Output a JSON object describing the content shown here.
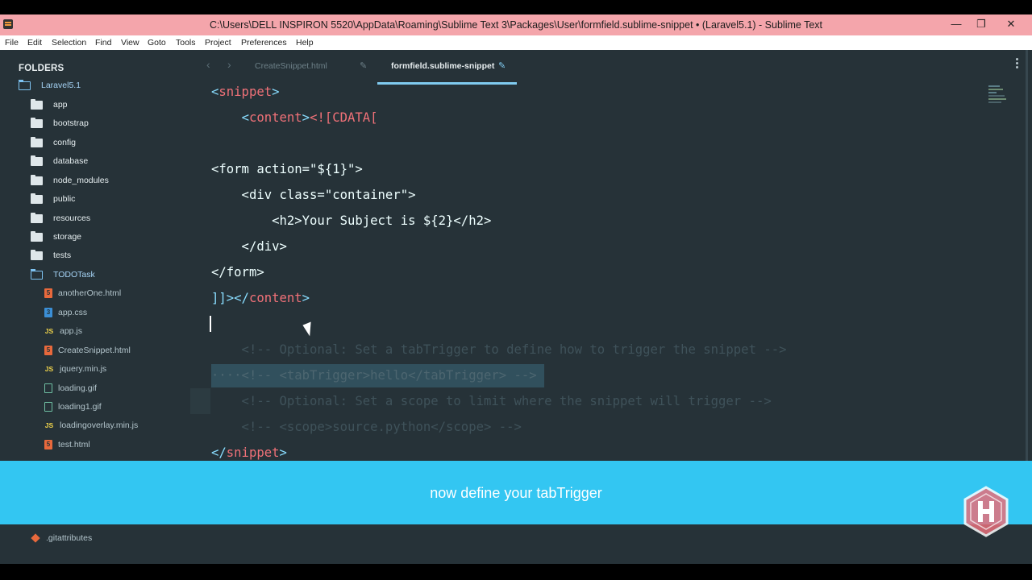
{
  "window": {
    "title": "C:\\Users\\DELL INSPIRON 5520\\AppData\\Roaming\\Sublime Text 3\\Packages\\User\\formfield.sublime-snippet • (Laravel5.1) - Sublime Text",
    "controls": {
      "minimize": "—",
      "maximize": "❐",
      "close": "✕"
    }
  },
  "menu": [
    "File",
    "Edit",
    "Selection",
    "Find",
    "View",
    "Goto",
    "Tools",
    "Project",
    "Preferences",
    "Help"
  ],
  "sidebar": {
    "header": "FOLDERS",
    "root": "Laravel5.1",
    "folders": [
      "app",
      "bootstrap",
      "config",
      "database",
      "node_modules",
      "public",
      "resources",
      "storage",
      "tests"
    ],
    "open_folder": "TODOTask",
    "files": [
      {
        "name": "anotherOne.html",
        "type": "html"
      },
      {
        "name": "app.css",
        "type": "css"
      },
      {
        "name": "app.js",
        "type": "js"
      },
      {
        "name": "CreateSnippet.html",
        "type": "html"
      },
      {
        "name": "jquery.min.js",
        "type": "js"
      },
      {
        "name": "loading.gif",
        "type": "image"
      },
      {
        "name": "loading1.gif",
        "type": "image"
      },
      {
        "name": "loadingoverlay.min.js",
        "type": "js"
      },
      {
        "name": "test.html",
        "type": "html"
      }
    ],
    "bottom_file": ".gitattributes"
  },
  "tabs": [
    {
      "label": "CreateSnippet.html",
      "active": false,
      "modified": true
    },
    {
      "label": "formfield.sublime-snippet",
      "active": true,
      "modified": true
    }
  ],
  "code": {
    "l1_tag": "snippet",
    "l2_tag": "content",
    "l2_cdata": "<![CDATA[",
    "l4": "<form action=\"${1}\">",
    "l5": "    <div class=\"container\">",
    "l6": "        <h2>Your Subject is ${2}</h2>",
    "l7": "    </div>",
    "l8": "</form>",
    "l9_cdata_end": "]]>",
    "l9_tag": "content",
    "l11": "    <!-- Optional: Set a tabTrigger to define how to trigger the snippet -->",
    "l12": "····<!-- <tabTrigger>hello</tabTrigger> -->",
    "l13": "    <!-- Optional: Set a scope to limit where the snippet will trigger -->",
    "l14": "    <!-- <scope>source.python</scope> -->",
    "l15_tag": "snippet"
  },
  "banner": {
    "text": "now define your tabTrigger"
  },
  "colors": {
    "editor_bg": "#263238",
    "banner_bg": "#33c6f2",
    "title_bg": "#f4a5ab",
    "tag": "#f07178",
    "tab_underline": "#80cbf0"
  }
}
